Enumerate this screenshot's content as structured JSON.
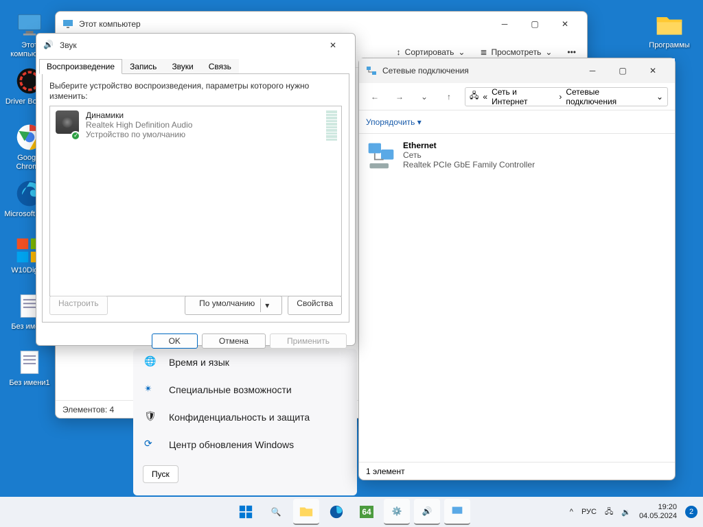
{
  "desktop": {
    "icons": [
      {
        "name": "this-pc",
        "label": "Этот компьютер"
      },
      {
        "name": "driver-booster",
        "label": "Driver Booster"
      },
      {
        "name": "chrome",
        "label": "Google Chrome"
      },
      {
        "name": "edge",
        "label": "Microsoft Edge"
      },
      {
        "name": "w10digital",
        "label": "W10Digital"
      },
      {
        "name": "doc1",
        "label": "Без имени"
      },
      {
        "name": "doc2",
        "label": "Без имени1"
      },
      {
        "name": "programs-folder",
        "label": "Программы"
      }
    ]
  },
  "pc_window": {
    "title": "Этот компьютер",
    "toolbar": {
      "sort": "Сортировать",
      "view": "Просмотреть"
    },
    "status": "Элементов: 4"
  },
  "net_window": {
    "title": "Сетевые подключения",
    "breadcrumb": {
      "parent": "Сеть и Интернет",
      "current": "Сетевые подключения",
      "sep": "›",
      "prefix": "«"
    },
    "organize": "Упорядочить",
    "item": {
      "name": "Ethernet",
      "subtitle": "Сеть",
      "device": "Realtek PCIe GbE Family Controller"
    },
    "status": "1 элемент"
  },
  "sound_dialog": {
    "title": "Звук",
    "tabs": [
      "Воспроизведение",
      "Запись",
      "Звуки",
      "Связь"
    ],
    "instruction": "Выберите устройство воспроизведения, параметры которого нужно изменить:",
    "device": {
      "name": "Динамики",
      "driver": "Realtek High Definition Audio",
      "status": "Устройство по умолчанию"
    },
    "buttons": {
      "configure": "Настроить",
      "default": "По умолчанию",
      "properties": "Свойства",
      "ok": "OK",
      "cancel": "Отмена",
      "apply": "Применить"
    }
  },
  "settings_fragment": {
    "rows": [
      {
        "icon": "globe-icon",
        "label": "Время и язык"
      },
      {
        "icon": "accessibility-icon",
        "label": "Специальные возможности"
      },
      {
        "icon": "shield-icon",
        "label": "Конфиденциальность и защита"
      },
      {
        "icon": "update-icon",
        "label": "Центр обновления Windows"
      }
    ],
    "start_button": "Пуск"
  },
  "taskbar": {
    "lang": "РУС",
    "time": "19:20",
    "date": "04.05.2024",
    "badge": "2"
  }
}
